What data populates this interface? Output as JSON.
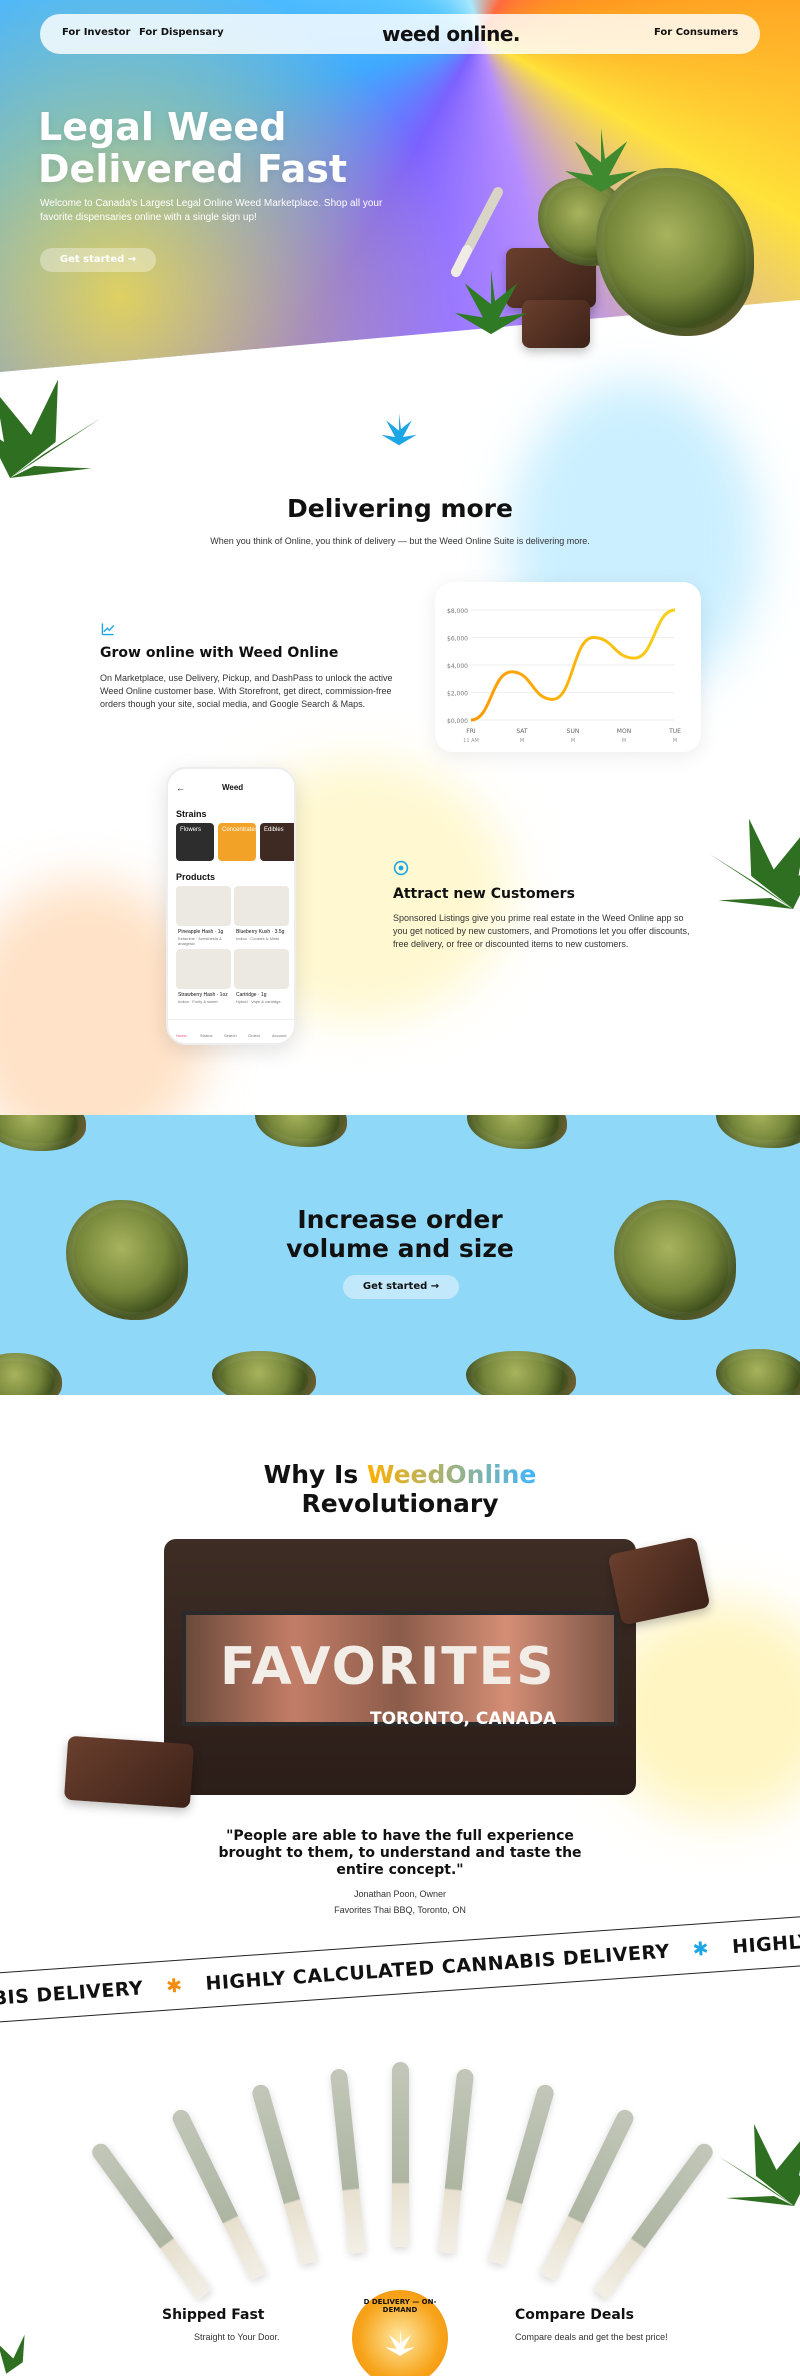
{
  "nav": {
    "left_links": [
      "For Investor",
      "For Dispensary"
    ],
    "logo": "weed online.",
    "right_link": "For Consumers"
  },
  "hero": {
    "title_line1": "Legal Weed",
    "title_line2": "Delivered Fast",
    "subtitle": "Welcome to Canada's Largest Legal Online Weed Marketplace. Shop all your favorite dispensaries online with a single sign up!",
    "cta": "Get started →"
  },
  "delivering": {
    "title": "Delivering more",
    "subtitle": "When you think of Online, you think of delivery — but the Weed Online Suite is delivering more."
  },
  "grow": {
    "title": "Grow online with Weed Online",
    "body": "On Marketplace, use Delivery, Pickup, and DashPass to unlock the active Weed Online customer base. With Storefront, get direct, commission-free orders though your site, social media, and Google Search & Maps."
  },
  "chart_data": {
    "type": "line",
    "x": [
      "FRI",
      "SAT",
      "SUN",
      "MON",
      "TUE"
    ],
    "x_sub": [
      "11 AM",
      "M",
      "M",
      "M",
      "M"
    ],
    "y_ticks": [
      "$8,000",
      "$6,000",
      "$4,000",
      "$2,000",
      "$0,000"
    ],
    "values": [
      0,
      3500,
      1500,
      6000,
      4500,
      8000
    ],
    "ylim": [
      0,
      8000
    ],
    "grid": true,
    "color_start": "#ff9800",
    "color_end": "#f7d21a"
  },
  "phone": {
    "title": "Weed",
    "strains_label": "Strains",
    "strain_tiles": [
      "Flowers",
      "Concentrates",
      "Edibles"
    ],
    "products_label": "Products",
    "products": [
      {
        "name": "Pineapple Hash · 1g",
        "meta": "Ketamine · Anesthesia & analgesic"
      },
      {
        "name": "Blueberry Kush · 3.5g",
        "meta": "Indica · Cookies & Mints"
      },
      {
        "name": "Strawberry Hash · 1oz",
        "meta": "Indica · Fruity & sweet"
      },
      {
        "name": "Cartridge · 1g",
        "meta": "Hybrid · Vape & cartridge"
      }
    ],
    "tabs": [
      "Home",
      "Strains",
      "Search",
      "Orders",
      "Account"
    ]
  },
  "attract": {
    "title": "Attract new Customers",
    "body": "Sponsored Listings give you prime real estate in the Weed Online app so you get noticed by new customers, and Promotions let you offer discounts, free delivery, or free or discounted items to new customers."
  },
  "order": {
    "title_line1": "Increase order",
    "title_line2": "volume and size",
    "cta": "Get started →"
  },
  "why": {
    "prefix": "Why Is ",
    "brand": "WeedOnline",
    "line2": "Revolutionary",
    "sign": "FAVORITES",
    "city": "TORONTO, CANADA",
    "quote": "\"People are able to have the full experience brought to them, to understand and taste the entire concept.\"",
    "author": "Jonathan Poon, Owner",
    "org": "Favorites Thai BBQ, Toronto, ON"
  },
  "ribbon": {
    "items": [
      "NABIS DELIVERY",
      "HIGHLY CALCULATED CANNABIS DELIVERY",
      "HIGHLY CALCULATED CANNABIS DELIVERY"
    ]
  },
  "features": {
    "left_title": "Shipped Fast",
    "left_sub": "Straight to Your Door.",
    "right_title": "Compare Deals",
    "right_sub": "Compare deals and get the best price!",
    "badge_text": "D DELIVERY — ON-DEMAND"
  }
}
